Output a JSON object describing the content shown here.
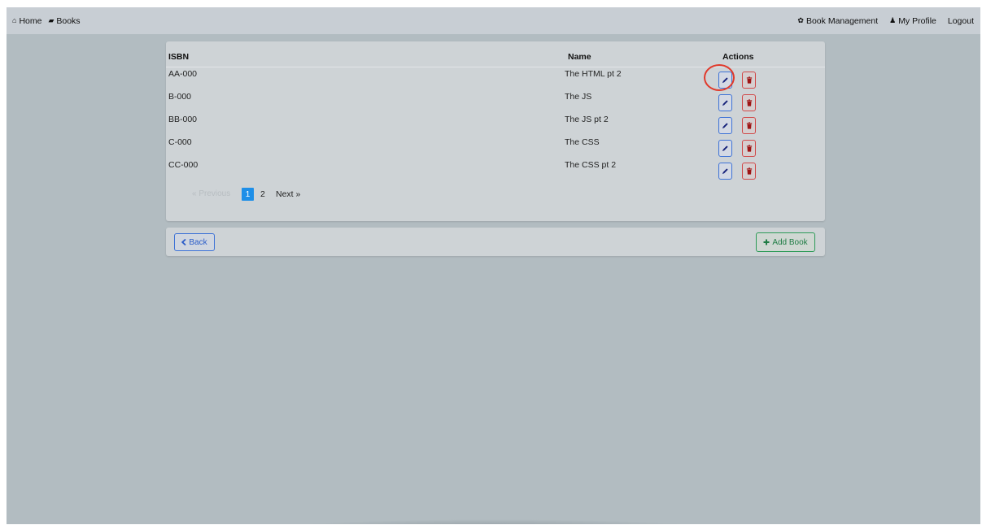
{
  "nav": {
    "home": {
      "icon": "home-icon",
      "glyph": "⌂",
      "label": "Home"
    },
    "books": {
      "icon": "book-icon",
      "glyph": "▰",
      "label": "Books"
    },
    "management": {
      "icon": "gear-icon",
      "glyph": "✿",
      "label": "Book Management"
    },
    "profile": {
      "icon": "user-icon",
      "glyph": "♟",
      "label": "My Profile"
    },
    "logout": {
      "label": "Logout"
    }
  },
  "table": {
    "headers": {
      "isbn": "ISBN",
      "name": "Name",
      "actions": "Actions"
    },
    "rows": [
      {
        "isbn": "AA-000",
        "name": "The HTML pt 2"
      },
      {
        "isbn": "B-000",
        "name": "The JS"
      },
      {
        "isbn": "BB-000",
        "name": "The JS pt 2"
      },
      {
        "isbn": "C-000",
        "name": "The CSS"
      },
      {
        "isbn": "CC-000",
        "name": "The CSS pt 2"
      }
    ],
    "edit_icon": "pencil-icon",
    "delete_icon": "trash-icon"
  },
  "pagination": {
    "previous": "« Previous",
    "pages": [
      "1",
      "2"
    ],
    "current": "1",
    "next": "Next »"
  },
  "footer": {
    "back_label": "Back",
    "back_icon": "chevron-left-icon",
    "add_label": "Add Book",
    "add_icon": "plus-icon"
  },
  "colors": {
    "primary": "#1e8fe8",
    "edit": "#3d72d6",
    "danger": "#d04a4a",
    "success": "#2c9a57",
    "highlight": "#e03a2c"
  }
}
